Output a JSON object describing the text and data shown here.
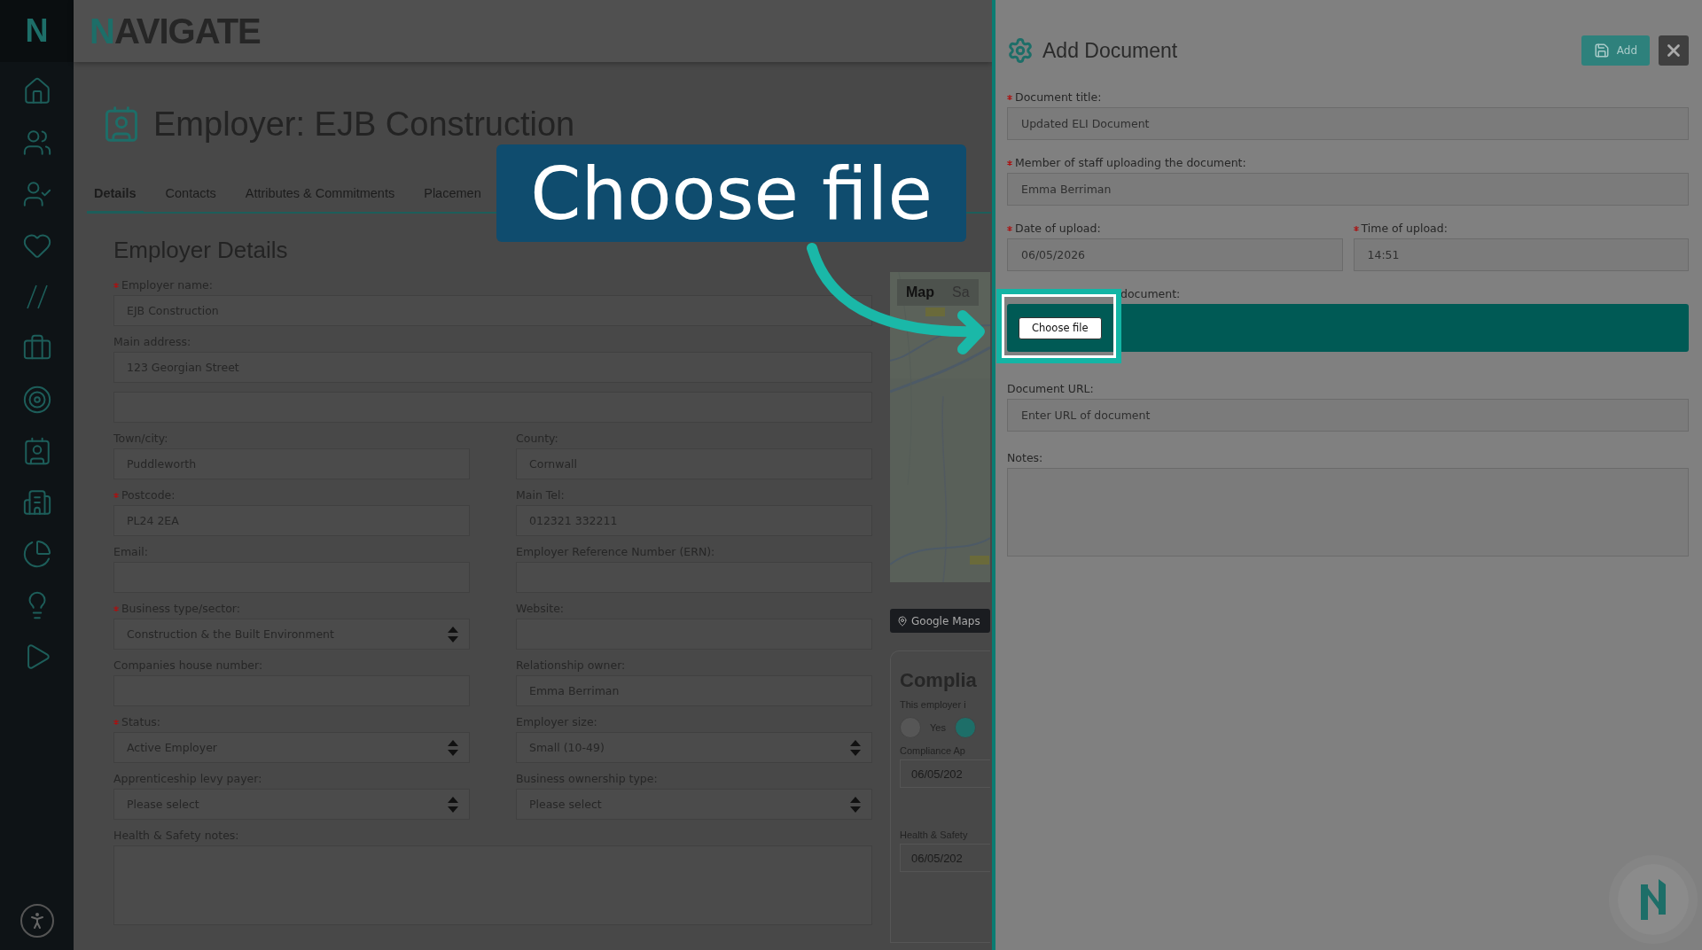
{
  "sidebar": {
    "logo": "N"
  },
  "header": {
    "brand": "NAVIGATE"
  },
  "page": {
    "title": "Employer: EJB Construction",
    "tabs": [
      {
        "label": "Details",
        "selected": true
      },
      {
        "label": "Contacts",
        "selected": false
      },
      {
        "label": "Attributes & Commitments",
        "selected": false
      },
      {
        "label": "Placemen",
        "selected": false
      }
    ]
  },
  "form": {
    "title": "Employer Details",
    "rows": [
      [
        {
          "kind": "text",
          "label": "Employer name:",
          "required": true,
          "value": "EJB Construction"
        }
      ],
      [
        {
          "kind": "text",
          "label": "Main address:",
          "required": false,
          "value": "123 Georgian Street"
        }
      ],
      [
        {
          "kind": "text"
        }
      ],
      [
        {
          "kind": "text",
          "label": "Town/city:",
          "required": false,
          "value": "Puddleworth"
        },
        {
          "kind": "text",
          "label": "County:",
          "required": false,
          "value": "Cornwall"
        }
      ],
      [
        {
          "kind": "text",
          "label": "Postcode:",
          "required": true,
          "value": "PL24 2EA"
        },
        {
          "kind": "text",
          "label": "Main Tel:",
          "required": false,
          "value": "012321 332211"
        }
      ],
      [
        {
          "kind": "text",
          "label": "Email:",
          "required": false
        },
        {
          "kind": "text",
          "label": "Employer Reference Number (ERN):",
          "required": false
        }
      ],
      [
        {
          "kind": "select",
          "label": "Business type/sector:",
          "required": true,
          "value": "Construction & the Built Environment"
        },
        {
          "kind": "text",
          "label": "Website:",
          "required": false
        }
      ],
      [
        {
          "kind": "text",
          "label": "Companies house number:",
          "required": false
        },
        {
          "kind": "text",
          "label": "Relationship owner:",
          "required": false,
          "value": "Emma Berriman"
        }
      ],
      [
        {
          "kind": "select",
          "label": "Status:",
          "required": true,
          "value": "Active Employer"
        },
        {
          "kind": "select",
          "label": "Employer size:",
          "required": false,
          "value": "Small (10-49)"
        }
      ],
      [
        {
          "kind": "select",
          "label": "Apprenticeship levy payer:",
          "required": false,
          "value": "Please select"
        },
        {
          "kind": "select",
          "label": "Business ownership type:",
          "required": false,
          "value": "Please select"
        }
      ],
      [
        {
          "kind": "textarea",
          "label": "Health & Safety notes:",
          "required": false
        }
      ]
    ]
  },
  "map": {
    "tabs": [
      {
        "label": "Map",
        "selected": true
      },
      {
        "label": "Sa",
        "selected": false
      }
    ],
    "button": "Google Maps"
  },
  "compliance": {
    "title": "Complia",
    "question": "This employer i",
    "options": [
      {
        "label": "Yes",
        "selected": false
      },
      {
        "selected": true
      }
    ],
    "fields": [
      {
        "label": "Compliance Ap",
        "value": "06/05/202"
      },
      {
        "label": "Health & Safety",
        "value": "06/05/202"
      }
    ]
  },
  "panel": {
    "title": "Add Document",
    "add_button": "Add",
    "rows": [
      [
        {
          "label": "Document title:",
          "required": true,
          "value": "Updated ELI Document"
        }
      ],
      [
        {
          "label": "Member of staff uploading the document:",
          "required": true,
          "value": "Emma Berriman"
        }
      ],
      [
        {
          "label": "Date of upload:",
          "required": true,
          "value": "06/05/2026"
        },
        {
          "label": "Time of upload:",
          "required": true,
          "value": "14:51"
        }
      ]
    ],
    "upload": {
      "label": "document:",
      "button": "Choose file"
    },
    "url": {
      "label": "Document URL:",
      "placeholder": "Enter URL of document"
    },
    "notes": {
      "label": "Notes:"
    }
  },
  "callout": {
    "text": "Choose file"
  }
}
